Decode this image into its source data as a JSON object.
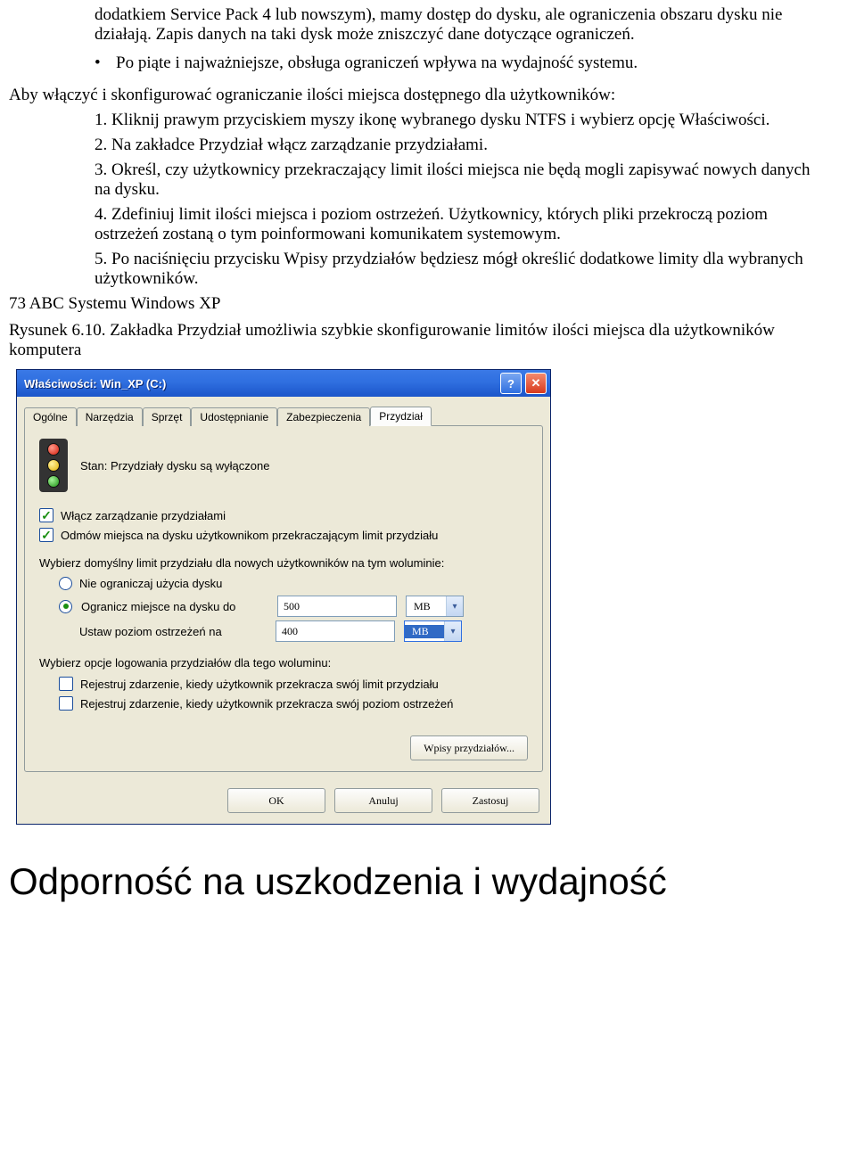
{
  "doc": {
    "para1": "dodatkiem Service Pack 4 lub nowszym), mamy dostęp do dysku, ale ograniczenia obszaru dysku nie działają. Zapis danych na taki dysk może zniszczyć dane dotyczące ograniczeń.",
    "bullet1": "Po piąte i najważniejsze, obsługa ograniczeń wpływa na wydajność systemu.",
    "para2": "Aby włączyć i skonfigurować ograniczanie ilości miejsca dostępnego dla użytkowników:",
    "step1": "1. Kliknij prawym przyciskiem myszy ikonę wybranego dysku NTFS i wybierz opcję Właściwości.",
    "step2": "2. Na zakładce Przydział włącz zarządzanie przydziałami.",
    "step3": "3. Określ, czy użytkownicy przekraczający limit ilości miejsca nie będą mogli zapisywać nowych danych na dysku.",
    "step4": "4. Zdefiniuj limit ilości miejsca i poziom ostrzeżeń. Użytkownicy, których pliki przekroczą poziom ostrzeżeń zostaną o tym poinformowani komunikatem systemowym.",
    "step5": "5. Po naciśnięciu przycisku Wpisy przydziałów będziesz mógł określić dodatkowe limity dla wybranych użytkowników.",
    "pageLine": "73 ABC Systemu Windows XP",
    "figCaption": "Rysunek 6.10. Zakładka Przydział umożliwia szybkie skonfigurowanie limitów ilości miejsca dla użytkowników komputera",
    "heading": "Odporność na uszkodzenia i wydajność"
  },
  "dialog": {
    "title": "Właściwości: Win_XP (C:)",
    "tabs": [
      "Ogólne",
      "Narzędzia",
      "Sprzęt",
      "Udostępnianie",
      "Zabezpieczenia",
      "Przydział"
    ],
    "activeTabIndex": 5,
    "statusLabel": "Stan:   Przydziały dysku są wyłączone",
    "chk1": "Włącz zarządzanie przydziałami",
    "chk2": "Odmów miejsca na dysku użytkownikom przekraczającym limit przydziału",
    "defaultText": "Wybierz domyślny limit przydziału dla nowych użytkowników na tym woluminie:",
    "radio1": "Nie ograniczaj użycia dysku",
    "radio2": "Ogranicz miejsce na dysku do",
    "limitValue": "500",
    "limitUnit": "MB",
    "warnLabel": "Ustaw poziom ostrzeżeń na",
    "warnValue": "400",
    "warnUnit": "MB",
    "logText": "Wybierz opcje logowania przydziałów dla tego woluminu:",
    "log1": "Rejestruj zdarzenie, kiedy użytkownik przekracza swój limit przydziału",
    "log2": "Rejestruj zdarzenie, kiedy użytkownik przekracza swój poziom ostrzeżeń",
    "entriesButton": "Wpisy przydziałów...",
    "buttons": {
      "ok": "OK",
      "cancel": "Anuluj",
      "apply": "Zastosuj"
    },
    "helpGlyph": "?",
    "closeGlyph": "✕",
    "arrowGlyph": "▾"
  }
}
